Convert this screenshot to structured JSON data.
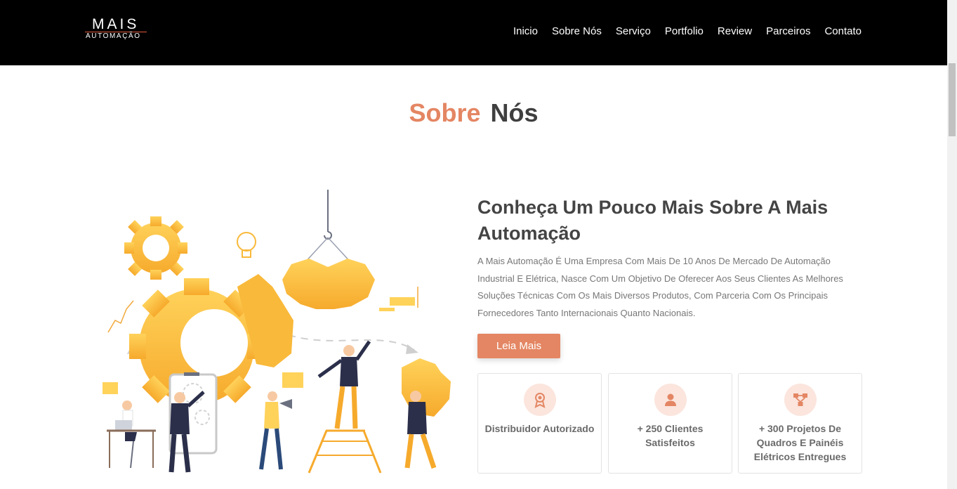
{
  "brand": {
    "logo_line1": "MAIS",
    "logo_line2": "AUTOMAÇÃO"
  },
  "nav": {
    "items": [
      {
        "label": "Inicio"
      },
      {
        "label": "Sobre Nós"
      },
      {
        "label": "Serviço"
      },
      {
        "label": "Portfolio"
      },
      {
        "label": "Review"
      },
      {
        "label": "Parceiros"
      },
      {
        "label": "Contato"
      }
    ]
  },
  "section": {
    "title_word1": "Sobre",
    "title_word2": "Nós"
  },
  "about": {
    "heading": "Conheça Um Pouco Mais Sobre A Mais Automação",
    "description": "A Mais Automação É Uma Empresa Com Mais De 10 Anos De Mercado De Automação Industrial E Elétrica, Nasce Com Um Objetivo De Oferecer Aos Seus Clientes As Melhores Soluções Técnicas Com Os Mais Diversos Produtos, Com Parceria Com Os Principais Fornecedores Tanto Internacionais Quanto Nacionais.",
    "button_label": "Leia Mais"
  },
  "features": [
    {
      "icon": "award-icon",
      "label": "Distribuidor Autorizado"
    },
    {
      "icon": "user-icon",
      "label": "+ 250 Clientes Satisfeitos"
    },
    {
      "icon": "network-icon",
      "label": "+ 300 Projetos De Quadros E Painéis Elétricos Entregues"
    }
  ],
  "colors": {
    "accent": "#e48663",
    "accent_light": "#fbe5dd",
    "header_bg": "#000000",
    "illustration_yellow": "#fbbf3f",
    "figure_navy": "#2b2f4a"
  }
}
